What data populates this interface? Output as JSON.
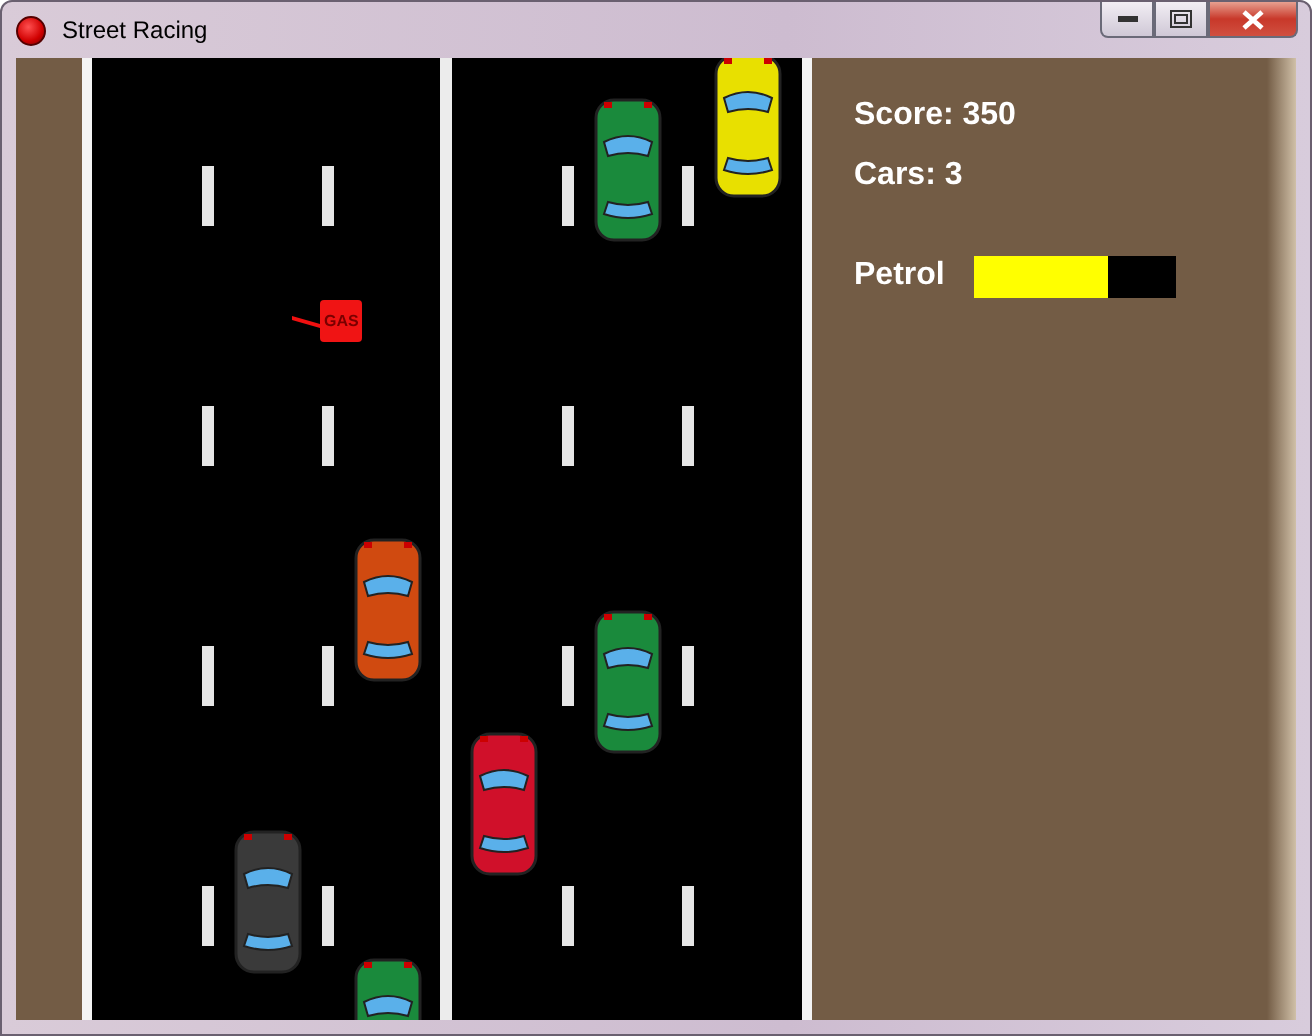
{
  "window": {
    "title": "Street Racing"
  },
  "hud": {
    "score": "Score: 350",
    "cars": "Cars: 3",
    "petrol": {
      "label": "Petrol",
      "level": 0.66
    }
  },
  "petrol_can": {
    "label": "GAS"
  },
  "cars": [
    {
      "color": "#e8e000"
    },
    {
      "color": "#1a8a3c"
    },
    {
      "color": "#d04a10"
    },
    {
      "color": "#1a8a3c"
    },
    {
      "color": "#d0102a"
    },
    {
      "color": "#3a3a3a"
    },
    {
      "color": "#1a8a3c"
    }
  ]
}
